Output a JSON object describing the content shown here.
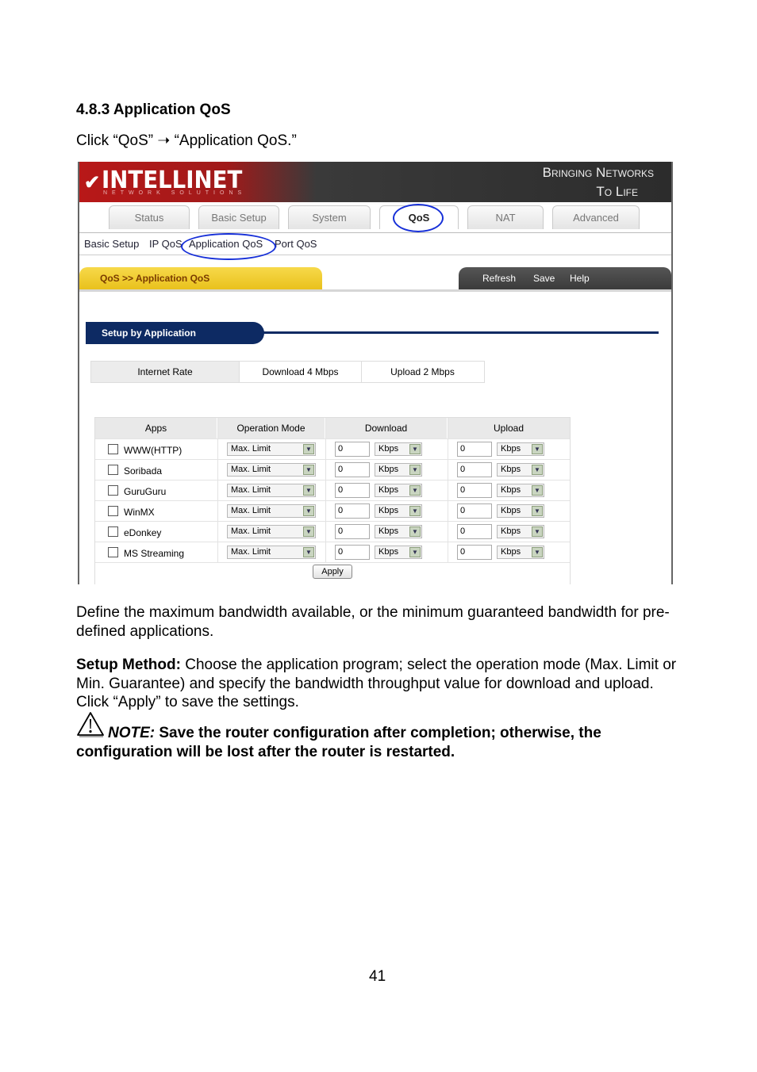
{
  "doc": {
    "heading": "4.8.3 Application QoS",
    "instruction": "Click “QoS” ➝ “Application QoS.”",
    "para1": "Define the maximum bandwidth available, or the minimum guaranteed bandwidth for pre-defined applications.",
    "setup_label": "Setup Method:",
    "setup_text": " Choose the application program; select the operation mode (Max. Limit or Min. Guarantee) and specify the bandwidth throughput value for download and upload. Click “Apply” to save the settings.",
    "note_label": "NOTE:",
    "note_text": " Save the router configuration after completion; otherwise, the configuration will be lost after the router is restarted.",
    "page_number": "41"
  },
  "router": {
    "logo": "INTELLINET",
    "logo_sub": "NETWORK SOLUTIONS",
    "slogan_line1": "Bringing Networks",
    "slogan_line2": "To Life",
    "tabs": [
      "Status",
      "Basic Setup",
      "System",
      "QoS",
      "NAT",
      "Advanced"
    ],
    "subnav": [
      "Basic Setup",
      "IP QoS",
      "Application QoS",
      "Port QoS"
    ],
    "breadcrumb": "QoS >> Application QoS",
    "actions": [
      "Refresh",
      "Save",
      "Help"
    ],
    "section_title": "Setup by Application",
    "internet_rate": {
      "label": "Internet Rate",
      "download": "Download 4 Mbps",
      "upload": "Upload 2 Mbps"
    },
    "table": {
      "headers": [
        "Apps",
        "Operation Mode",
        "Download",
        "Upload"
      ],
      "rows": [
        {
          "app": "WWW(HTTP)",
          "mode": "Max. Limit",
          "down": "0",
          "down_unit": "Kbps",
          "up": "0",
          "up_unit": "Kbps"
        },
        {
          "app": "Soribada",
          "mode": "Max. Limit",
          "down": "0",
          "down_unit": "Kbps",
          "up": "0",
          "up_unit": "Kbps"
        },
        {
          "app": "GuruGuru",
          "mode": "Max. Limit",
          "down": "0",
          "down_unit": "Kbps",
          "up": "0",
          "up_unit": "Kbps"
        },
        {
          "app": "WinMX",
          "mode": "Max. Limit",
          "down": "0",
          "down_unit": "Kbps",
          "up": "0",
          "up_unit": "Kbps"
        },
        {
          "app": "eDonkey",
          "mode": "Max. Limit",
          "down": "0",
          "down_unit": "Kbps",
          "up": "0",
          "up_unit": "Kbps"
        },
        {
          "app": "MS Streaming",
          "mode": "Max. Limit",
          "down": "0",
          "down_unit": "Kbps",
          "up": "0",
          "up_unit": "Kbps"
        }
      ]
    },
    "apply_label": "Apply",
    "highlight_color": "#1730d8"
  }
}
